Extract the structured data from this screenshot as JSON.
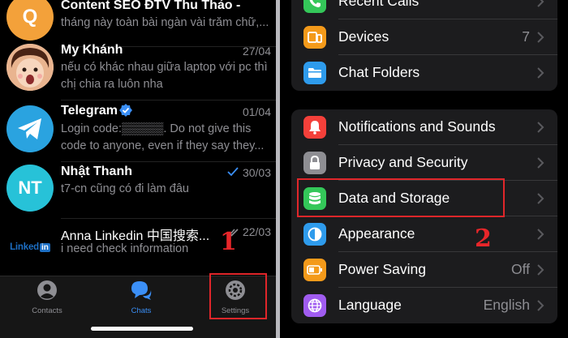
{
  "chats": [
    {
      "name": "Content SEO ĐTV Thu Thảo -",
      "date": "",
      "message": "tháng này toàn bài ngàn vài trăm chữ,...",
      "message2": "",
      "avatar_initial": "Q",
      "avatar_color": "#f3a13a",
      "read_icon": ""
    },
    {
      "name": "My Khánh",
      "date": "27/04",
      "message": "nếu có khác nhau giữa laptop với pc thì",
      "message2": "chị chia ra luôn nha",
      "avatar_initial": "",
      "avatar_color": "#7a3b20",
      "read_icon": ""
    },
    {
      "name": "Telegram",
      "date": "01/04",
      "message": "Login code:▒▒▒▒▒. Do not give this",
      "message2": "code to anyone, even if they say they...",
      "avatar_initial": "",
      "avatar_color": "#2aa3e0",
      "read_icon": "verified-badge-icon"
    },
    {
      "name": "Nhật Thanh",
      "date": "30/03",
      "message": "t7-cn cũng có đi làm đâu",
      "message2": "",
      "avatar_initial": "NT",
      "avatar_color": "#27c2d8",
      "read_icon": "single-check-icon"
    },
    {
      "name": "Anna Linkedin 中国搜索...",
      "date": "22/03",
      "message": "i need check information",
      "message2": "",
      "avatar_initial": "Linked",
      "avatar_color": "#000000",
      "read_icon": "double-check-icon"
    }
  ],
  "linkedin_logo": {
    "word": "Linked",
    "badge": "in"
  },
  "tabs": [
    {
      "label": "Contacts",
      "icon": "person-icon",
      "active": false
    },
    {
      "label": "Chats",
      "icon": "chat-bubbles-icon",
      "active": true
    },
    {
      "label": "Settings",
      "icon": "gear-icon",
      "active": false
    }
  ],
  "steps": {
    "step1": "1",
    "step2": "2"
  },
  "settings": {
    "group1": [
      {
        "label": "Recent Calls",
        "value": "",
        "icon": "phone-icon",
        "color": "#34c759"
      },
      {
        "label": "Devices",
        "value": "7",
        "icon": "devices-icon",
        "color": "#f49a1a"
      },
      {
        "label": "Chat Folders",
        "value": "",
        "icon": "folder-icon",
        "color": "#2e9bec"
      }
    ],
    "group2": [
      {
        "label": "Notifications and Sounds",
        "value": "",
        "icon": "bell-icon",
        "color": "#f4403a"
      },
      {
        "label": "Privacy and Security",
        "value": "",
        "icon": "lock-icon",
        "color": "#8e8e93"
      },
      {
        "label": "Data and Storage",
        "value": "",
        "icon": "database-icon",
        "color": "#34c759"
      },
      {
        "label": "Appearance",
        "value": "",
        "icon": "appearance-icon",
        "color": "#2e9bec"
      },
      {
        "label": "Power Saving",
        "value": "Off",
        "icon": "battery-icon",
        "color": "#f49a1a"
      },
      {
        "label": "Language",
        "value": "English",
        "icon": "globe-icon",
        "color": "#a05cf0"
      }
    ]
  },
  "colors": {
    "accent": "#3b8ff6",
    "highlight": "#e0262a",
    "background": "#000000",
    "card": "#1c1c1e"
  }
}
